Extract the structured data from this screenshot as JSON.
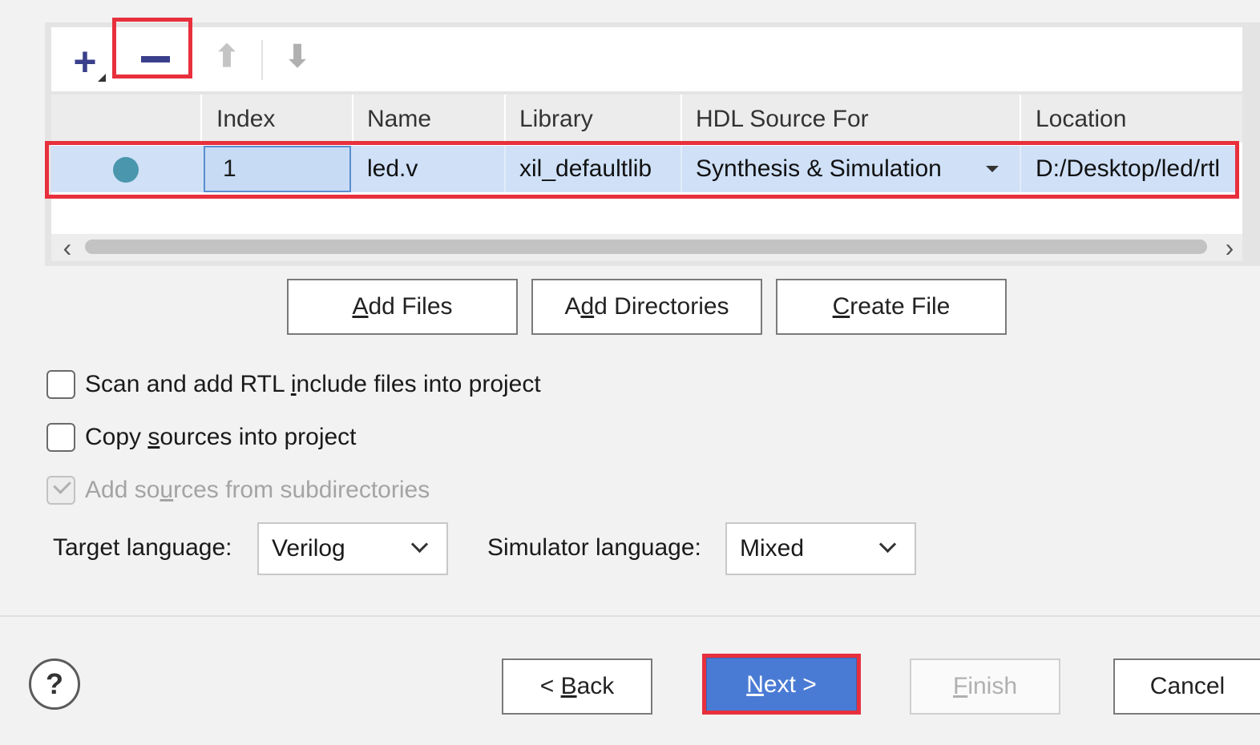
{
  "toolbar": {
    "icons": [
      "add-icon",
      "remove-icon",
      "move-up-icon",
      "move-down-icon"
    ]
  },
  "table": {
    "columns": [
      "",
      "Index",
      "Name",
      "Library",
      "HDL Source For",
      "Location"
    ],
    "rows": [
      {
        "status_icon": "file-status-dot",
        "index": "1",
        "name": "led.v",
        "library": "xil_defaultlib",
        "hdl_source_for": "Synthesis & Simulation",
        "location": "D:/Desktop/led/rtl"
      }
    ]
  },
  "file_buttons": {
    "add_files": {
      "pre": "",
      "ul": "A",
      "post": "dd Files"
    },
    "add_directories": {
      "pre": "A",
      "ul": "d",
      "post": "d Directories"
    },
    "create_file": {
      "pre": "",
      "ul": "C",
      "post": "reate File"
    }
  },
  "options": {
    "scan_rtl": {
      "pre": "Scan and add RTL ",
      "ul": "i",
      "post": "nclude files into project",
      "checked": false,
      "enabled": true
    },
    "copy_sources": {
      "pre": "Copy ",
      "ul": "s",
      "post": "ources into project",
      "checked": false,
      "enabled": true
    },
    "add_subdirs": {
      "pre": "Add so",
      "ul": "u",
      "post": "rces from subdirectories",
      "checked": true,
      "enabled": false
    }
  },
  "language": {
    "target_label": "Target language:",
    "target_value": "Verilog",
    "simulator_label": "Simulator language:",
    "simulator_value": "Mixed"
  },
  "nav": {
    "help": "?",
    "back": {
      "pre": "< ",
      "ul": "B",
      "post": "ack"
    },
    "next": {
      "pre": "",
      "ul": "N",
      "post": "ext >"
    },
    "finish": {
      "pre": "",
      "ul": "F",
      "post": "inish"
    },
    "cancel": "Cancel"
  },
  "colors": {
    "highlight": "#e8303d",
    "selection": "#cfe0f7",
    "primary_button": "#4a7bd4",
    "status_dot": "#4a96ad"
  }
}
